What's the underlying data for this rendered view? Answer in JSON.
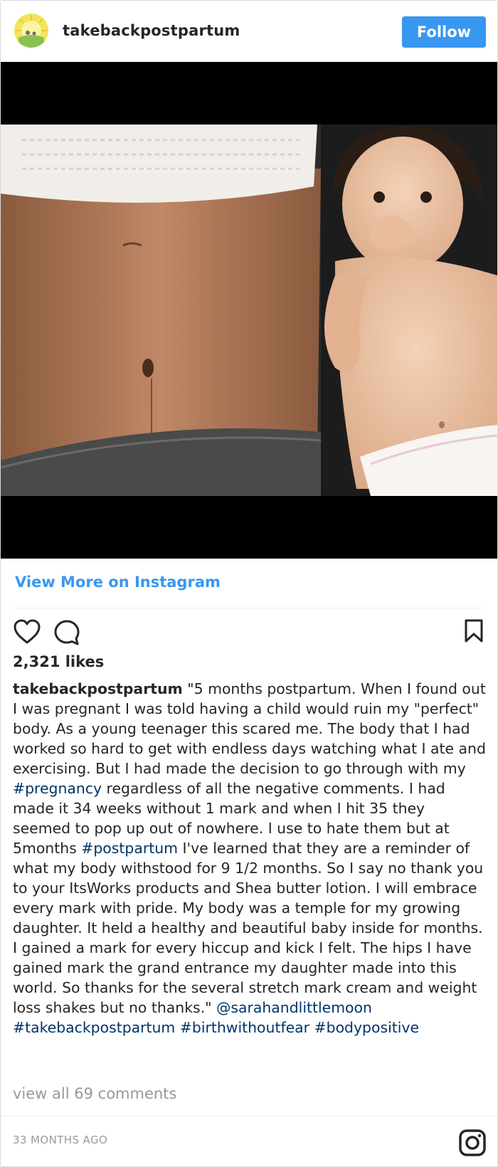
{
  "header": {
    "username": "takebackpostpartum",
    "follow_label": "Follow"
  },
  "post": {
    "view_more_label": "View More on Instagram",
    "likes": "2,321 likes",
    "caption": {
      "user": "takebackpostpartum",
      "text1": " \"5 months postpartum. When I found out I was pregnant I was told having a child would ruin my \"perfect\" body. As a young teenager this scared me. The body that I had worked so hard to get with endless days watching what I ate and exercising. But I had made the decision to go through with my ",
      "tag_pregnancy": "#pregnancy",
      "text2": " regardless of all the negative comments. I had made it 34 weeks without 1 mark and when I hit 35 they seemed to pop up out of nowhere. I use to hate them but at 5months ",
      "tag_postpartum": "#postpartum",
      "text3": " I've learned that they are a reminder of what my body withstood for 9 1/2 months. So I say no thank you to your ItsWorks products and Shea butter lotion. I will embrace every mark with pride. My body was a temple for my growing daughter. It held a healthy and beautiful baby inside for months. I gained a mark for every hiccup and kick I felt. The hips I have gained mark the grand entrance my daughter made into this world. So thanks for the several stretch mark cream and weight loss shakes but no thanks.\" ",
      "mention": "@sarahandlittlemoon",
      "tag_takeback": "#takebackpostpartum",
      "tag_birth": "#birthwithoutfear",
      "tag_body": "#bodypositive"
    },
    "view_comments_label": "view all 69 comments",
    "timestamp": "33 MONTHS AGO"
  },
  "icons": {
    "like": "heart-icon",
    "comment": "comment-icon",
    "save": "bookmark-icon",
    "instagram": "instagram-logo-icon"
  },
  "colors": {
    "accent": "#3897f0",
    "hashtag": "#003569",
    "muted": "#999999"
  }
}
